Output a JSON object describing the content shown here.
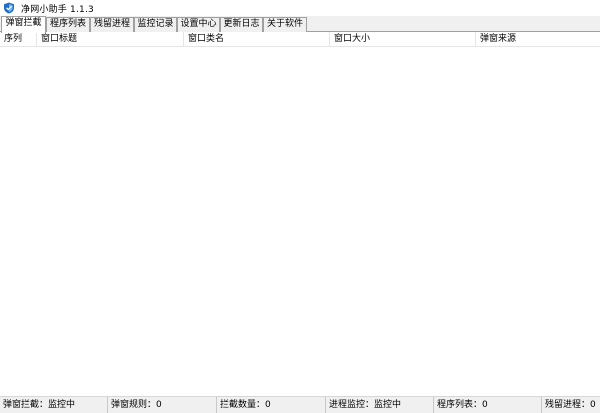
{
  "window": {
    "title": "净网小助手 1.1.3",
    "icon": "shield-app-icon"
  },
  "tabs": [
    {
      "label": "弹窗拦截",
      "active": true
    },
    {
      "label": "程序列表",
      "active": false
    },
    {
      "label": "残留进程",
      "active": false
    },
    {
      "label": "监控记录",
      "active": false
    },
    {
      "label": "设置中心",
      "active": false
    },
    {
      "label": "更新日志",
      "active": false
    },
    {
      "label": "关于软件",
      "active": false
    }
  ],
  "table": {
    "columns": [
      "序列",
      "窗口标题",
      "窗口类名",
      "窗口大小",
      "弹窗来源"
    ],
    "rows": []
  },
  "statusbar": {
    "items": [
      "弹窗拦截：监控中",
      "弹窗规则：0",
      "拦截数量：0",
      "进程监控：监控中",
      "程序列表：0",
      "残留进程：0"
    ]
  },
  "colors": {
    "tab_border": "#a0a0a0",
    "chrome_bg": "#f0f0f0",
    "icon_blue": "#1f6fc8"
  }
}
